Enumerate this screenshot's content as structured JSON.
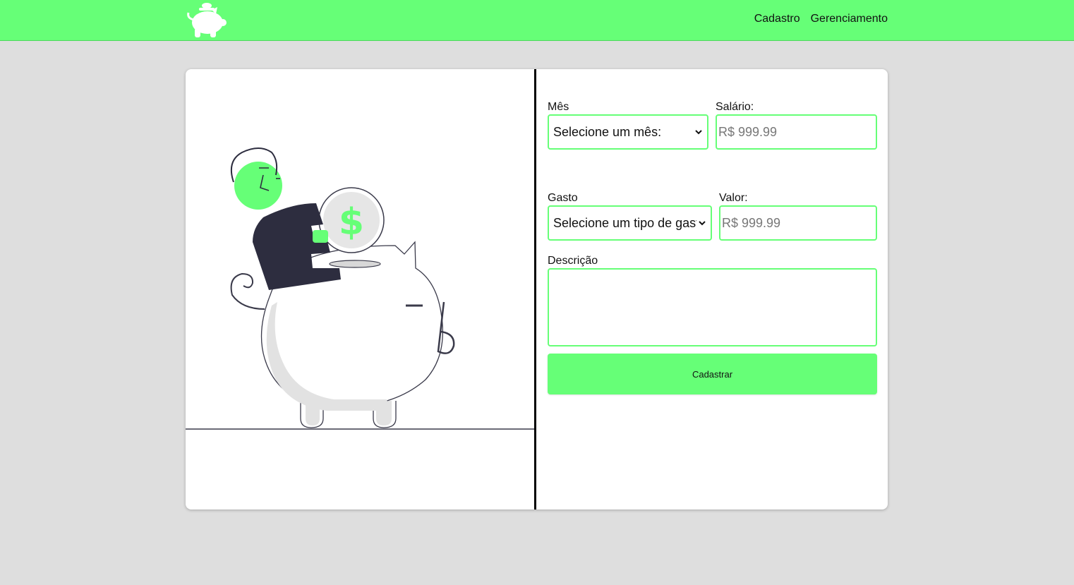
{
  "app": {
    "logo_icon": "piggy-bank-icon",
    "brand_color": "#66ff77"
  },
  "nav": {
    "items": [
      {
        "label": "Cadastro"
      },
      {
        "label": "Gerenciamento"
      }
    ]
  },
  "illustration": {
    "coin_symbol": "$",
    "icon": "person-saving-money-illustration"
  },
  "form": {
    "month": {
      "label": "Mês",
      "selected": "Selecione um mês:"
    },
    "salary": {
      "label": "Salário:",
      "placeholder": "R$ 999.99"
    },
    "expense": {
      "label": "Gasto",
      "selected": "Selecione um tipo de gasto"
    },
    "value": {
      "label": "Valor:",
      "placeholder": "R$ 999.99"
    },
    "description": {
      "label": "Descrição",
      "value": ""
    },
    "submit_label": "Cadastrar"
  }
}
